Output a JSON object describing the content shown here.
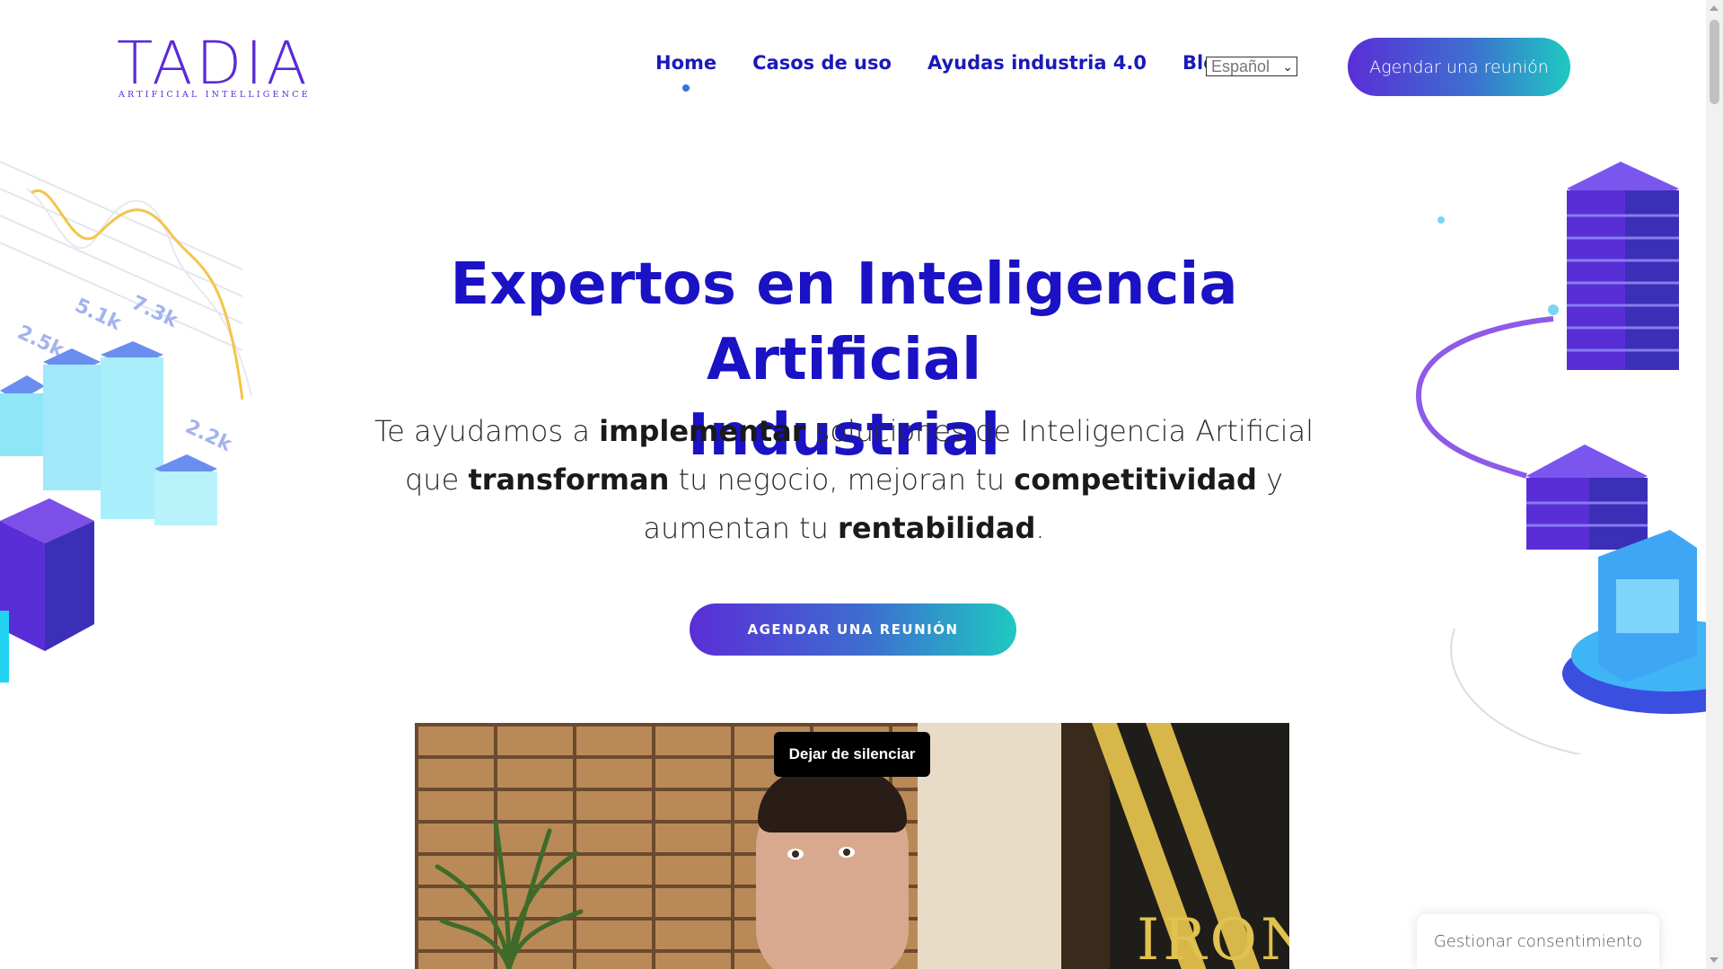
{
  "header": {
    "logo_word": "TADIA",
    "logo_tagline": "ARTIFICIAL INTELLIGENCE",
    "nav": [
      {
        "label": "Home",
        "active": true
      },
      {
        "label": "Casos de uso",
        "active": false
      },
      {
        "label": "Ayudas industria 4.0",
        "active": false
      },
      {
        "label": "Blog",
        "active": false
      }
    ],
    "language": "Español",
    "cta_label": "Agendar una reunión"
  },
  "hero": {
    "title_line1": "Expertos en Inteligencia Artificial",
    "title_line2": "Industrial",
    "subtitle": {
      "p1": "Te ayudamos a ",
      "b1": "implementar",
      "p2": " soluciones de Inteligencia Artificial que ",
      "b2": "transforman",
      "p3": " tu negocio, mejoran tu ",
      "b3": "competitividad",
      "p4": " y aumentan tu ",
      "b4": "rentabilidad",
      "p5": "."
    },
    "cta_label": "AGENDAR UNA REUNIÓN"
  },
  "illustration": {
    "left_labels": [
      "2.5k",
      "5.1k",
      "7.3k",
      "2.2k"
    ]
  },
  "video": {
    "unmute_label": "Dejar de silenciar",
    "poster_text": "IRON"
  },
  "consent": {
    "label": "Gestionar consentimiento"
  },
  "colors": {
    "primary": "#1a12c4",
    "gradient_start": "#5a2ed6",
    "gradient_end": "#1ec9c1",
    "active_dot": "#3b6fe0"
  }
}
